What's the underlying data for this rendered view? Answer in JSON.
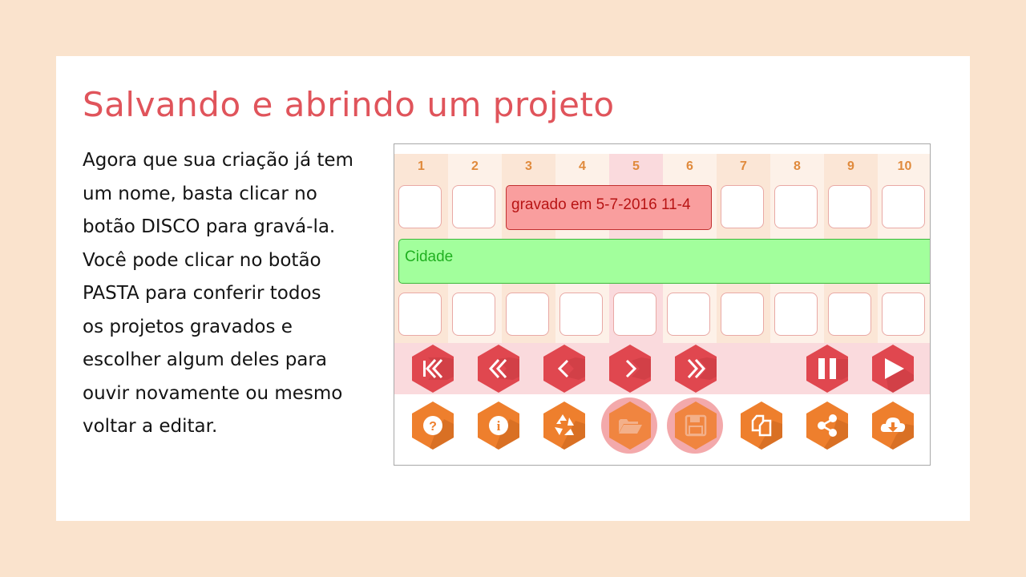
{
  "slide": {
    "title": "Salvando e abrindo um projeto",
    "lines": [
      "Agora que sua criação já tem",
      "um nome, basta clicar no",
      "botão DISCO para gravá-la.",
      "Você pode clicar no botão",
      "PASTA para conferir todos",
      "os projetos gravados e",
      "escolher algum deles para",
      "ouvir novamente ou mesmo",
      "voltar a editar."
    ]
  },
  "editor": {
    "columns": [
      "1",
      "2",
      "3",
      "4",
      "5",
      "6",
      "7",
      "8",
      "9",
      "10"
    ],
    "red_clip": "gravado em 5-7-2016 11-4",
    "green_clip": "Cidade",
    "colors": {
      "red_clip": "#f99e9e",
      "green_clip": "#a2ff9c",
      "transport": "#e0474f",
      "tools": "#ee7f2d"
    },
    "transport_buttons": [
      "skip-to-start-icon",
      "rewind-icon",
      "previous-icon",
      "next-icon",
      "fast-forward-icon",
      "pause-icon",
      "play-icon"
    ],
    "tool_buttons": [
      "help-icon",
      "info-icon",
      "recycle-icon",
      "folder-icon",
      "disk-icon",
      "copy-icon",
      "share-icon",
      "cloud-download-icon"
    ]
  }
}
